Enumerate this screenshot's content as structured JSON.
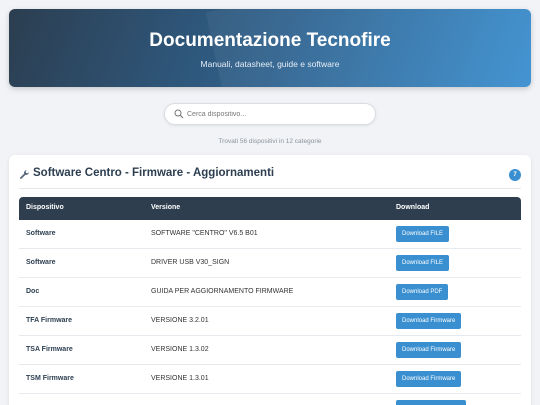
{
  "header": {
    "title": "Documentazione Tecnofire",
    "subtitle": "Manuali, datasheet, guide e software"
  },
  "search": {
    "placeholder": "Cerca dispositivo...",
    "icon": "search-icon"
  },
  "results_text": "Trovati 56 dispositivi in 12 categorie",
  "category": {
    "icon": "wrench-icon",
    "title": "Software Centro - Firmware - Aggiornamenti",
    "count": "7"
  },
  "table": {
    "headers": [
      "Dispositivo",
      "Versione",
      "Download"
    ],
    "rows": [
      {
        "device": "Software",
        "version": "SOFTWARE \"CENTRO\" V6.5 B01",
        "button": "Download FILE"
      },
      {
        "device": "Software",
        "version": "DRIVER USB V30_SIGN",
        "button": "Download FILE"
      },
      {
        "device": "Doc",
        "version": "GUIDA PER AGGIORNAMENTO FIRMWARE",
        "button": "Download PDF"
      },
      {
        "device": "TFA Firmware",
        "version": "VERSIONE 3.2.01",
        "button": "Download Firmware"
      },
      {
        "device": "TSA Firmware",
        "version": "VERSIONE 1.3.02",
        "button": "Download Firmware"
      },
      {
        "device": "TSM Firmware",
        "version": "VERSIONE 1.3.01",
        "button": "Download Firmware"
      },
      {
        "device": "",
        "version": "",
        "button": ""
      }
    ]
  },
  "colors": {
    "accent": "#3a8fd0",
    "header_dark": "#2c3e50",
    "table_head": "#2f3e4e"
  }
}
